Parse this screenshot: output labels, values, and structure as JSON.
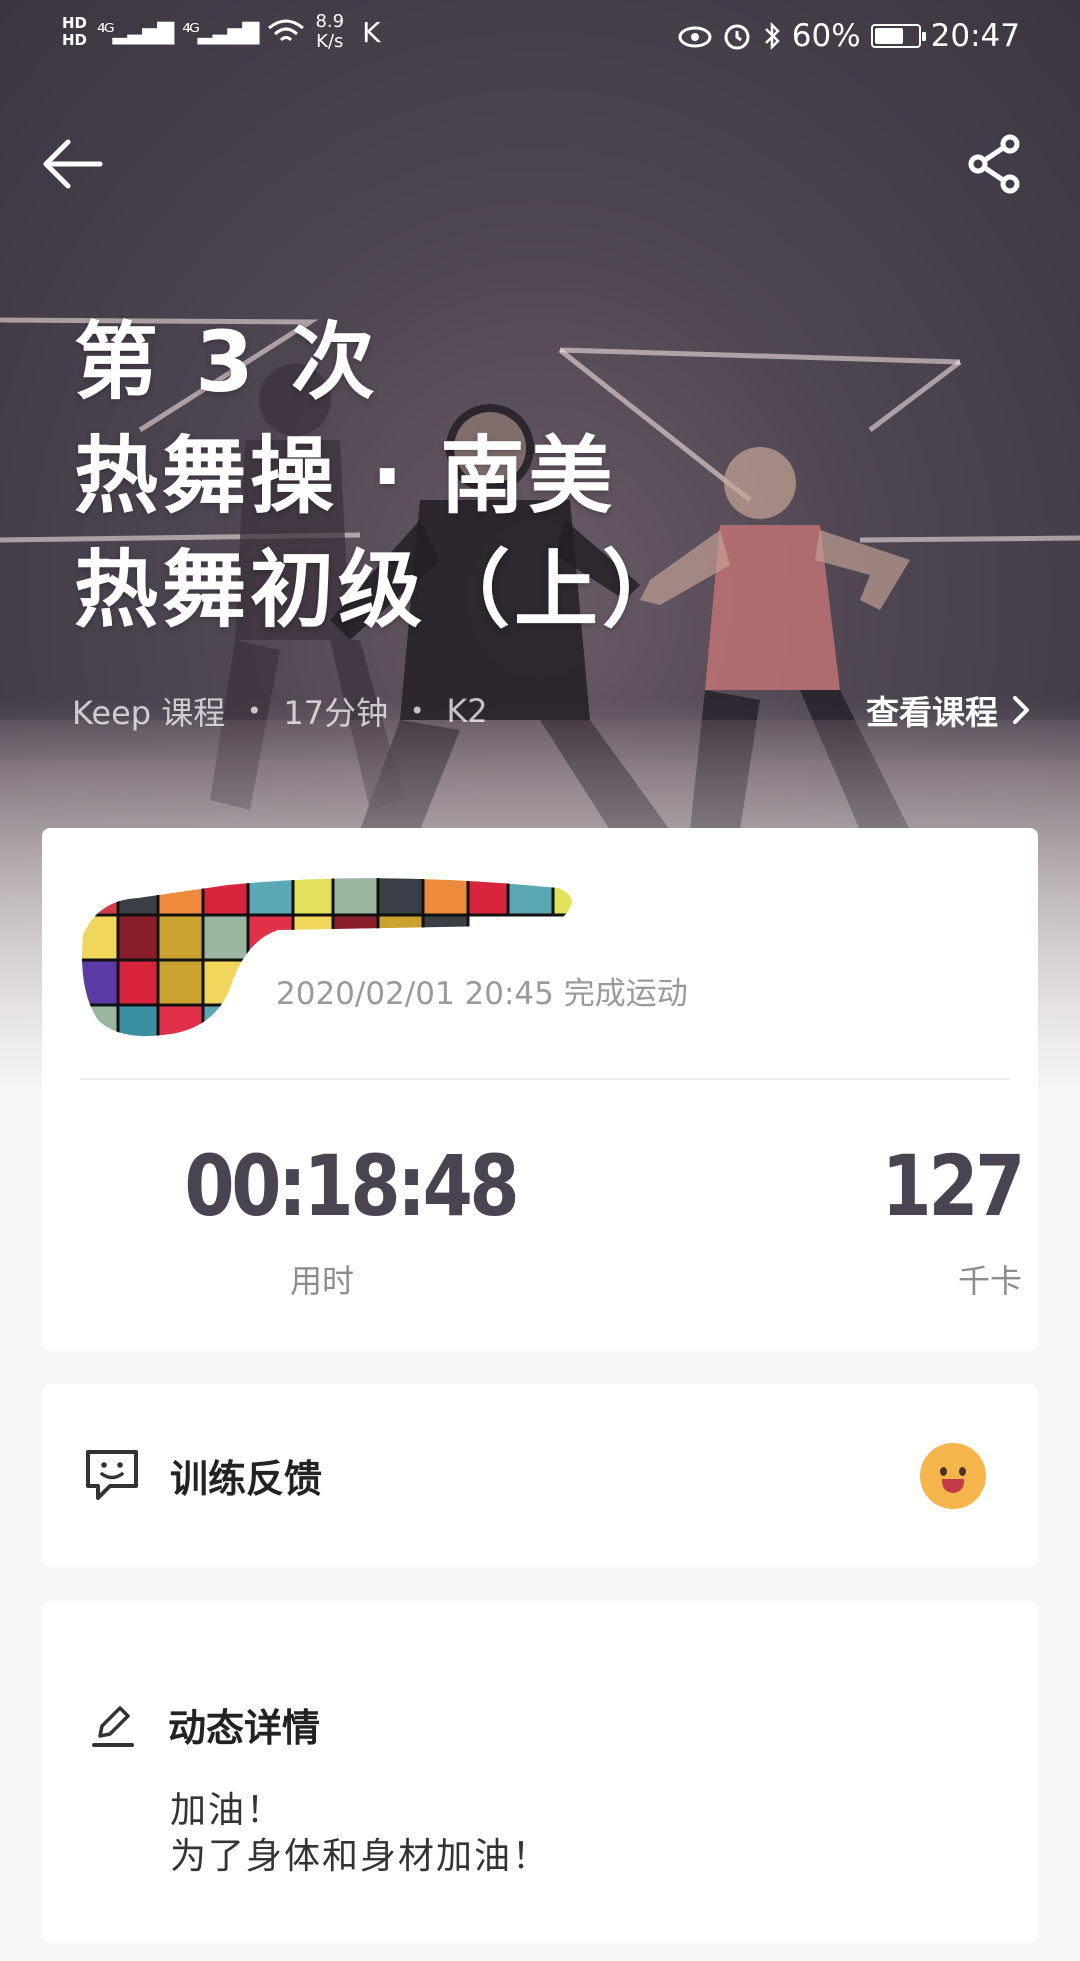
{
  "status_bar": {
    "hd1": "HD",
    "hd2": "HD",
    "network_speed_value": "8.9",
    "network_speed_unit": "K/s",
    "app_letter": "K",
    "battery": "60%",
    "time": "20:47"
  },
  "nav": {
    "back_icon": "arrow-left-icon",
    "share_icon": "share-icon"
  },
  "hero": {
    "title_lines": [
      "第 3 次",
      "热舞操 · 南美",
      "热舞初级（上）"
    ],
    "meta": [
      "Keep 课程",
      "17分钟",
      "K2"
    ],
    "meta_separator": "•",
    "view_course": "查看课程"
  },
  "summary": {
    "finish_time": "2020/02/01 20:45 完成运动",
    "duration_value": "00:18:48",
    "duration_label": "用时",
    "calories_value": "127",
    "calories_label": "千卡"
  },
  "feedback": {
    "title": "训练反馈",
    "icon": "feedback-chat-icon",
    "emoji": "happy-face-icon"
  },
  "post": {
    "title": "动态详情",
    "icon": "pencil-icon",
    "lines": [
      "加油！",
      "为了身体和身材加油！"
    ]
  },
  "colors": {
    "stat_value": "#4a4452",
    "label_gray": "#8c8c8c",
    "hero_bg": "#4e4552",
    "page_bg": "#f7f7f7"
  }
}
